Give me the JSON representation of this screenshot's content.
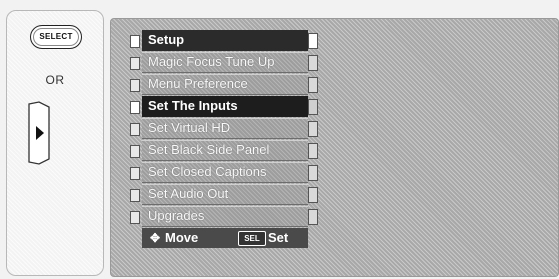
{
  "remote": {
    "select_button_label": "SELECT",
    "or_label": "OR",
    "nav_icon": "play-right-arrow"
  },
  "menu": {
    "title": "Setup",
    "items": [
      {
        "label": "Magic Focus Tune Up"
      },
      {
        "label": "Menu Preference"
      },
      {
        "label": "Set The Inputs",
        "selected": true
      },
      {
        "label": "Set Virtual HD"
      },
      {
        "label": "Set Black Side Panel"
      },
      {
        "label": "Set Closed Captions"
      },
      {
        "label": "Set Audio Out"
      },
      {
        "label": "Upgrades"
      }
    ],
    "footer": {
      "move_label": "Move",
      "sel_badge": "SEL",
      "set_label": "Set"
    }
  }
}
